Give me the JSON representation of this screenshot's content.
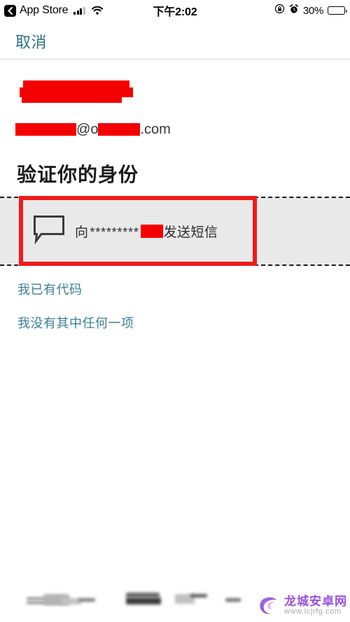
{
  "status_bar": {
    "back_label": "App Store",
    "back_icon": "chevron-left-icon",
    "signal_icon": "cellular-signal-icon",
    "wifi_icon": "wifi-icon",
    "time": "下午2:02",
    "rotation_lock_icon": "rotation-lock-icon",
    "alarm_icon": "alarm-clock-icon",
    "battery_percent": "30%",
    "battery_level": 30
  },
  "nav_bar": {
    "cancel_label": "取消"
  },
  "account": {
    "name_redacted": true,
    "email_prefix_redacted": true,
    "email_at": "@",
    "email_domain_first": "o",
    "email_domain_redacted": true,
    "email_suffix": ".com"
  },
  "page": {
    "heading": "验证你的身份"
  },
  "options": [
    {
      "icon": "chat-bubble-icon",
      "prefix": "向",
      "masked_number": "*********",
      "number_redacted": true,
      "action_label": "发送短信",
      "highlighted": true,
      "highlight_color": "#ee1c1c",
      "row_background": "#e9e9e9"
    }
  ],
  "links": [
    {
      "label": "我已有代码",
      "name": "have-code-link"
    },
    {
      "label": "我没有其中任何一项",
      "name": "none-of-these-link"
    }
  ],
  "watermark": {
    "logo_icon": "lc-swirl-logo-icon",
    "title": "龙城安卓网",
    "url": "www.lcjrfg.com",
    "brand_color": "#9b4fd6"
  },
  "colors": {
    "link_blue": "#3b7f93",
    "cancel_blue": "#2f6f80",
    "redaction_red": "#f50000",
    "annotation_red": "#ee1c1c",
    "row_gray": "#e9e9e9"
  }
}
